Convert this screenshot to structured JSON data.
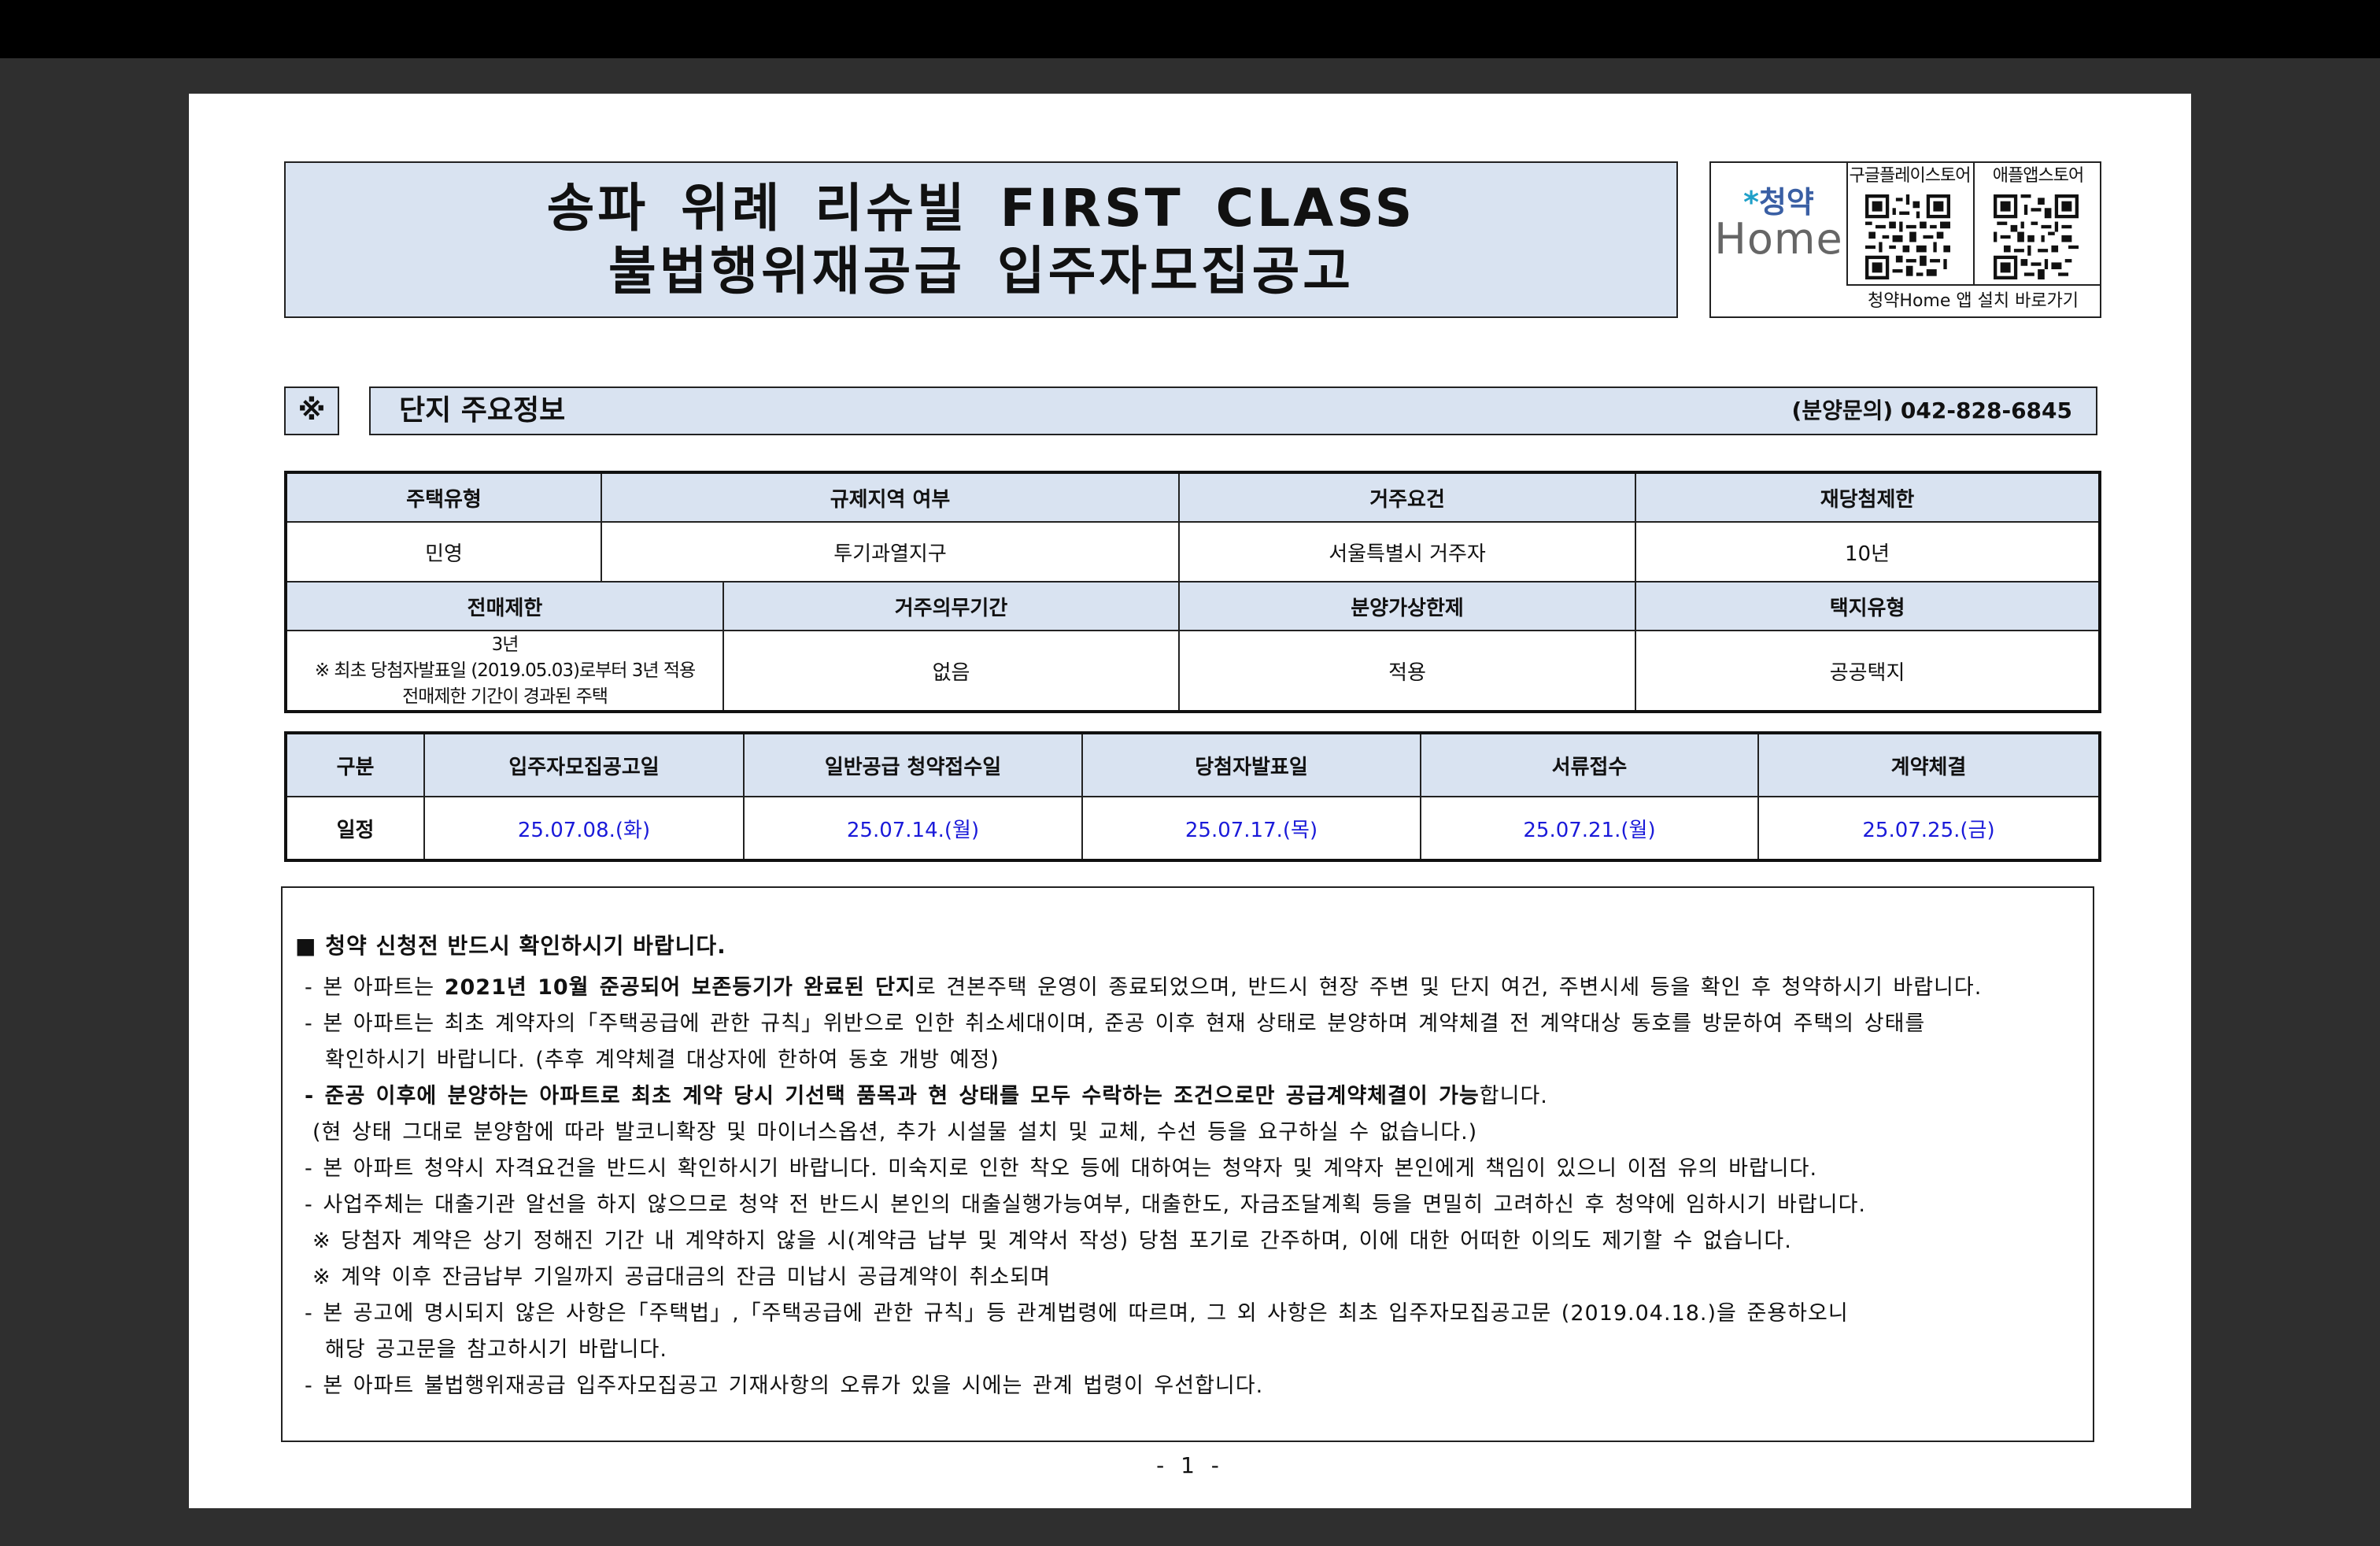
{
  "title": {
    "line1": "송파 위례 리슈빌 FIRST CLASS",
    "line2": "불법행위재공급 입주자모집공고"
  },
  "app_panel": {
    "logo_top": "청약",
    "logo_bottom": "Home",
    "qr1_label": "구글플레이스토어",
    "qr2_label": "애플앱스토어",
    "footer": "청약Home 앱 설치 바로가기"
  },
  "section": {
    "mark": "※",
    "title": "단지 주요정보",
    "contact": "(분양문의) 042-828-6845"
  },
  "info": {
    "row1_headers": [
      "주택유형",
      "규제지역 여부",
      "거주요건",
      "재당첨제한"
    ],
    "row1_values": [
      "민영",
      "투기과열지구",
      "서울특별시 거주자",
      "10년"
    ],
    "row2_headers": [
      "전매제한",
      "거주의무기간",
      "분양가상한제",
      "택지유형"
    ],
    "resale_limit": {
      "line1": "3년",
      "line2": "※ 최초 당첨자발표일 (2019.05.03)로부터 3년 적용",
      "line3": "전매제한 기간이 경과된 주택"
    },
    "row2_values": [
      "없음",
      "적용",
      "공공택지"
    ]
  },
  "schedule": {
    "headers": [
      "구분",
      "입주자모집공고일",
      "일반공급 청약접수일",
      "당첨자발표일",
      "서류접수",
      "계약체결"
    ],
    "row_label": "일정",
    "dates": [
      "25.07.08.(화)",
      "25.07.14.(월)",
      "25.07.17.(목)",
      "25.07.21.(월)",
      "25.07.25.(금)"
    ],
    "date_color": "#1a1ad9"
  },
  "notice": {
    "heading": "■ 청약 신청전 반드시 확인하시기 바랍니다.",
    "l1_a": "- 본 아파트는 ",
    "l1_b": "2021년 10월 준공되어 보존등기가 완료된 단지",
    "l1_c": "로 견본주택 운영이 종료되었으며, 반드시 현장 주변 및 단지 여건, 주변시세 등을 확인 후 청약하시기 바랍니다.",
    "l2": "- 본 아파트는 최초 계약자의「주택공급에 관한 규칙」위반으로 인한 취소세대이며, 준공 이후 현재 상태로 분양하며 계약체결 전 계약대상 동호를 방문하여 주택의 상태를",
    "l3": "확인하시기 바랍니다. (추후 계약체결 대상자에 한하여 동호 개방 예정)",
    "l4_a": "- 준공 이후에 분양하는 아파트로 최초 계약 당시 기선택 품목과 현 상태를 모두 수락하는 조건으로만 공급계약체결이 가능",
    "l4_b": "합니다.",
    "l5": "(현 상태 그대로 분양함에 따라 발코니확장 및 마이너스옵션, 추가 시설물 설치 및 교체, 수선 등을 요구하실 수 없습니다.)",
    "l6": "- 본 아파트 청약시 자격요건을 반드시 확인하시기 바랍니다. 미숙지로 인한 착오 등에 대하여는 청약자 및 계약자 본인에게 책임이 있으니 이점 유의 바랍니다.",
    "l7": "- 사업주체는 대출기관 알선을 하지 않으므로 청약 전 반드시 본인의 대출실행가능여부, 대출한도, 자금조달계획 등을 면밀히 고려하신 후 청약에 임하시기 바랍니다.",
    "l8": "※ 당첨자 계약은 상기 정해진 기간 내 계약하지 않을 시(계약금 납부 및 계약서 작성) 당첨 포기로 간주하며, 이에 대한 어떠한 이의도 제기할 수 없습니다.",
    "l9": "※ 계약 이후 잔금납부 기일까지 공급대금의 잔금 미납시 공급계약이 취소되며",
    "l10": "- 본 공고에 명시되지 않은 사항은「주택법」,「주택공급에 관한 규칙」등 관계법령에 따르며, 그 외 사항은 최초 입주자모집공고문 (2019.04.18.)을 준용하오니",
    "l11": "해당 공고문을 참고하시기 바랍니다.",
    "l12": "- 본 아파트 불법행위재공급 입주자모집공고 기재사항의 오류가 있을 시에는 관계 법령이 우선합니다."
  },
  "page_number": "- 1 -"
}
